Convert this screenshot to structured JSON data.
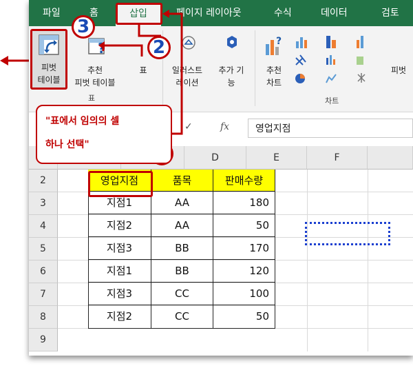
{
  "tabs": [
    {
      "label": "파일"
    },
    {
      "label": "홈"
    },
    {
      "label": "삽입",
      "active": true
    },
    {
      "label": "페이지 레이아웃"
    },
    {
      "label": "수식"
    },
    {
      "label": "데이터"
    },
    {
      "label": "검토"
    }
  ],
  "ribbon": {
    "pivot_table": {
      "line1": "피벗",
      "line2": "테이블"
    },
    "recommended_pivot": {
      "line1": "추천",
      "line2": "피벗 테이블"
    },
    "table": {
      "label": "표"
    },
    "group_table_label": "표",
    "illustrations": {
      "line1": "일러스트",
      "line2": "레이션"
    },
    "addins": {
      "line1": "추가 기",
      "line2": "능"
    },
    "recommended_charts": {
      "line1": "추천",
      "line2": "차트"
    },
    "pivot_chart_partial": "피벗",
    "group_charts_label": "차트"
  },
  "formula_bar": {
    "fx": "fx",
    "value": "영업지점"
  },
  "columns": [
    "D",
    "E",
    "F"
  ],
  "rows": [
    "2",
    "3",
    "4",
    "5",
    "6",
    "7",
    "8",
    "9"
  ],
  "table": {
    "headers": [
      "영업지점",
      "품목",
      "판매수량"
    ],
    "rows": [
      [
        "지점1",
        "AA",
        "180"
      ],
      [
        "지점2",
        "AA",
        "50"
      ],
      [
        "지점3",
        "BB",
        "170"
      ],
      [
        "지점1",
        "BB",
        "120"
      ],
      [
        "지점3",
        "CC",
        "100"
      ],
      [
        "지점2",
        "CC",
        "50"
      ]
    ]
  },
  "callout": {
    "line1": "\"표에서 임의의 셀",
    "line2": "하나 선택\""
  },
  "badges": {
    "one": "1",
    "two": "2",
    "three": "3"
  },
  "colors": {
    "excel_green": "#217346",
    "annotation_red": "#c00000",
    "badge_blue": "#1a4bb5",
    "header_yellow": "#ffff00",
    "dotted_blue": "#1a3fd0"
  }
}
